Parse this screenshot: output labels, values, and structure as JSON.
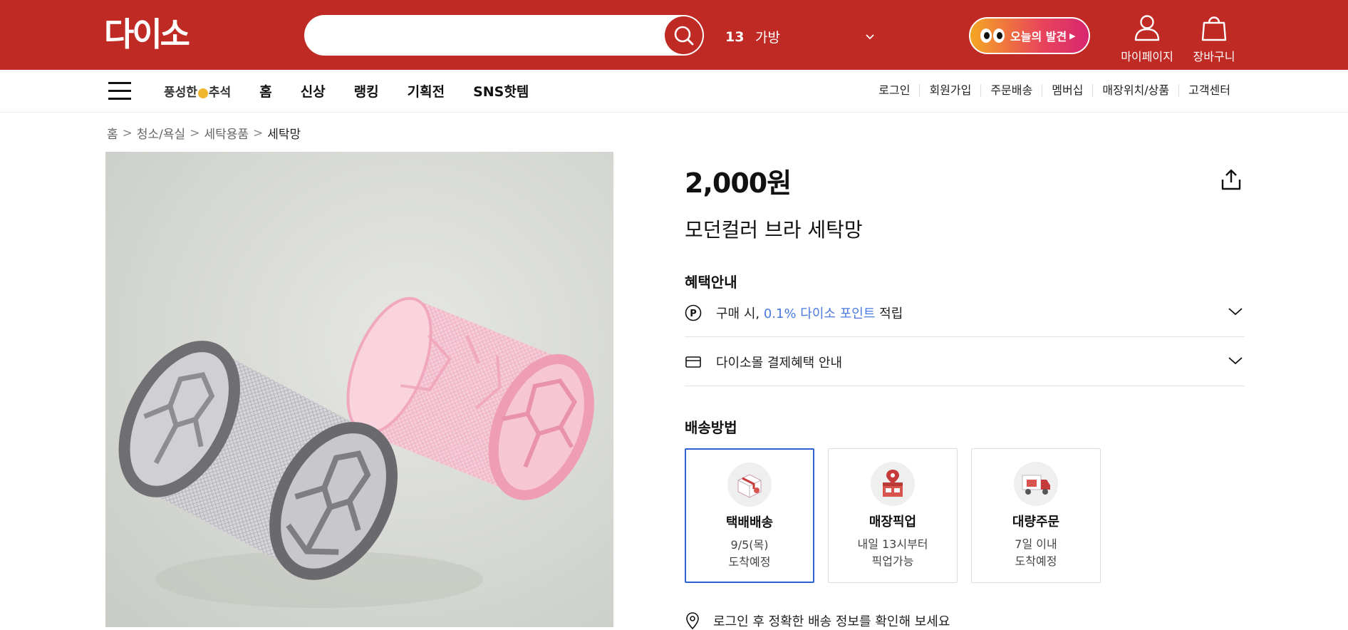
{
  "header": {
    "logo_text": "다이소",
    "search_placeholder": "",
    "rank_number": "13",
    "rank_keyword": "가방",
    "today_find_label": "오늘의 발견",
    "mypage_label": "마이페이지",
    "cart_label": "장바구니"
  },
  "nav": {
    "promo_left": "풍성한",
    "promo_right": "추석",
    "items": [
      "홈",
      "신상",
      "랭킹",
      "기획전",
      "SNS핫템"
    ],
    "util": [
      "로그인",
      "회원가입",
      "주문배송",
      "멤버십",
      "매장위치/상품",
      "고객센터"
    ]
  },
  "breadcrumb": [
    "홈",
    "청소/욕실",
    "세탁용품",
    "세탁망"
  ],
  "product": {
    "price": "2,000원",
    "name": "모던컬러 브라 세탁망"
  },
  "benefits": {
    "title": "혜택안내",
    "point_prefix": "구매 시, ",
    "point_highlight": "0.1% 다이소 포인트",
    "point_suffix": " 적립",
    "payment_text": "다이소몰 결제혜택 안내"
  },
  "shipping": {
    "title": "배송방법",
    "options": [
      {
        "title": "택배배송",
        "line1": "9/5(목)",
        "line2": "도착예정",
        "selected": true
      },
      {
        "title": "매장픽업",
        "line1": "내일 13시부터",
        "line2": "픽업가능",
        "selected": false
      },
      {
        "title": "대량주문",
        "line1": "7일 이내",
        "line2": "도착예정",
        "selected": false
      }
    ],
    "login_message": "로그인 후 정확한 배송 정보를 확인해 보세요"
  },
  "colors": {
    "brand_red": "#bf2a25",
    "link_blue": "#4a7ae0",
    "selected_border": "#2e5fcf"
  }
}
